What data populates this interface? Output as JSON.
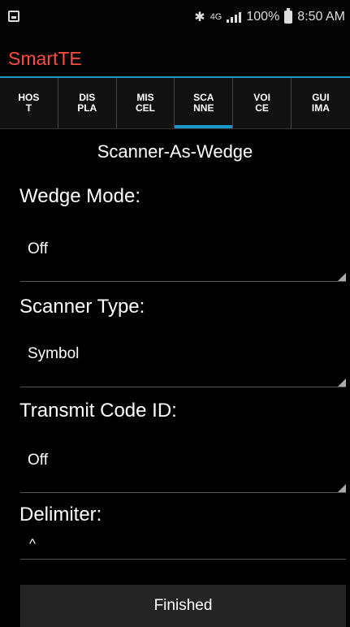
{
  "status": {
    "battery": "100%",
    "time": "8:50 AM",
    "network": "4G"
  },
  "app": {
    "title": "SmartTE"
  },
  "tabs": [
    {
      "label": "HOS\nT"
    },
    {
      "label": "DIS\nPLA"
    },
    {
      "label": "MIS\nCEL"
    },
    {
      "label": "SCA\nNNE"
    },
    {
      "label": "VOI\nCE"
    },
    {
      "label": "GUI\nIMA"
    }
  ],
  "page": {
    "title": "Scanner-As-Wedge"
  },
  "fields": {
    "wedge_mode": {
      "label": "Wedge Mode:",
      "value": "Off"
    },
    "scanner_type": {
      "label": "Scanner Type:",
      "value": "Symbol"
    },
    "transmit_code_id": {
      "label": "Transmit Code ID:",
      "value": "Off"
    },
    "delimiter": {
      "label": "Delimiter:",
      "value": "^"
    }
  },
  "actions": {
    "finished": "Finished"
  },
  "colors": {
    "accent": "#1c95c9",
    "app_title": "#ff4b3f"
  }
}
